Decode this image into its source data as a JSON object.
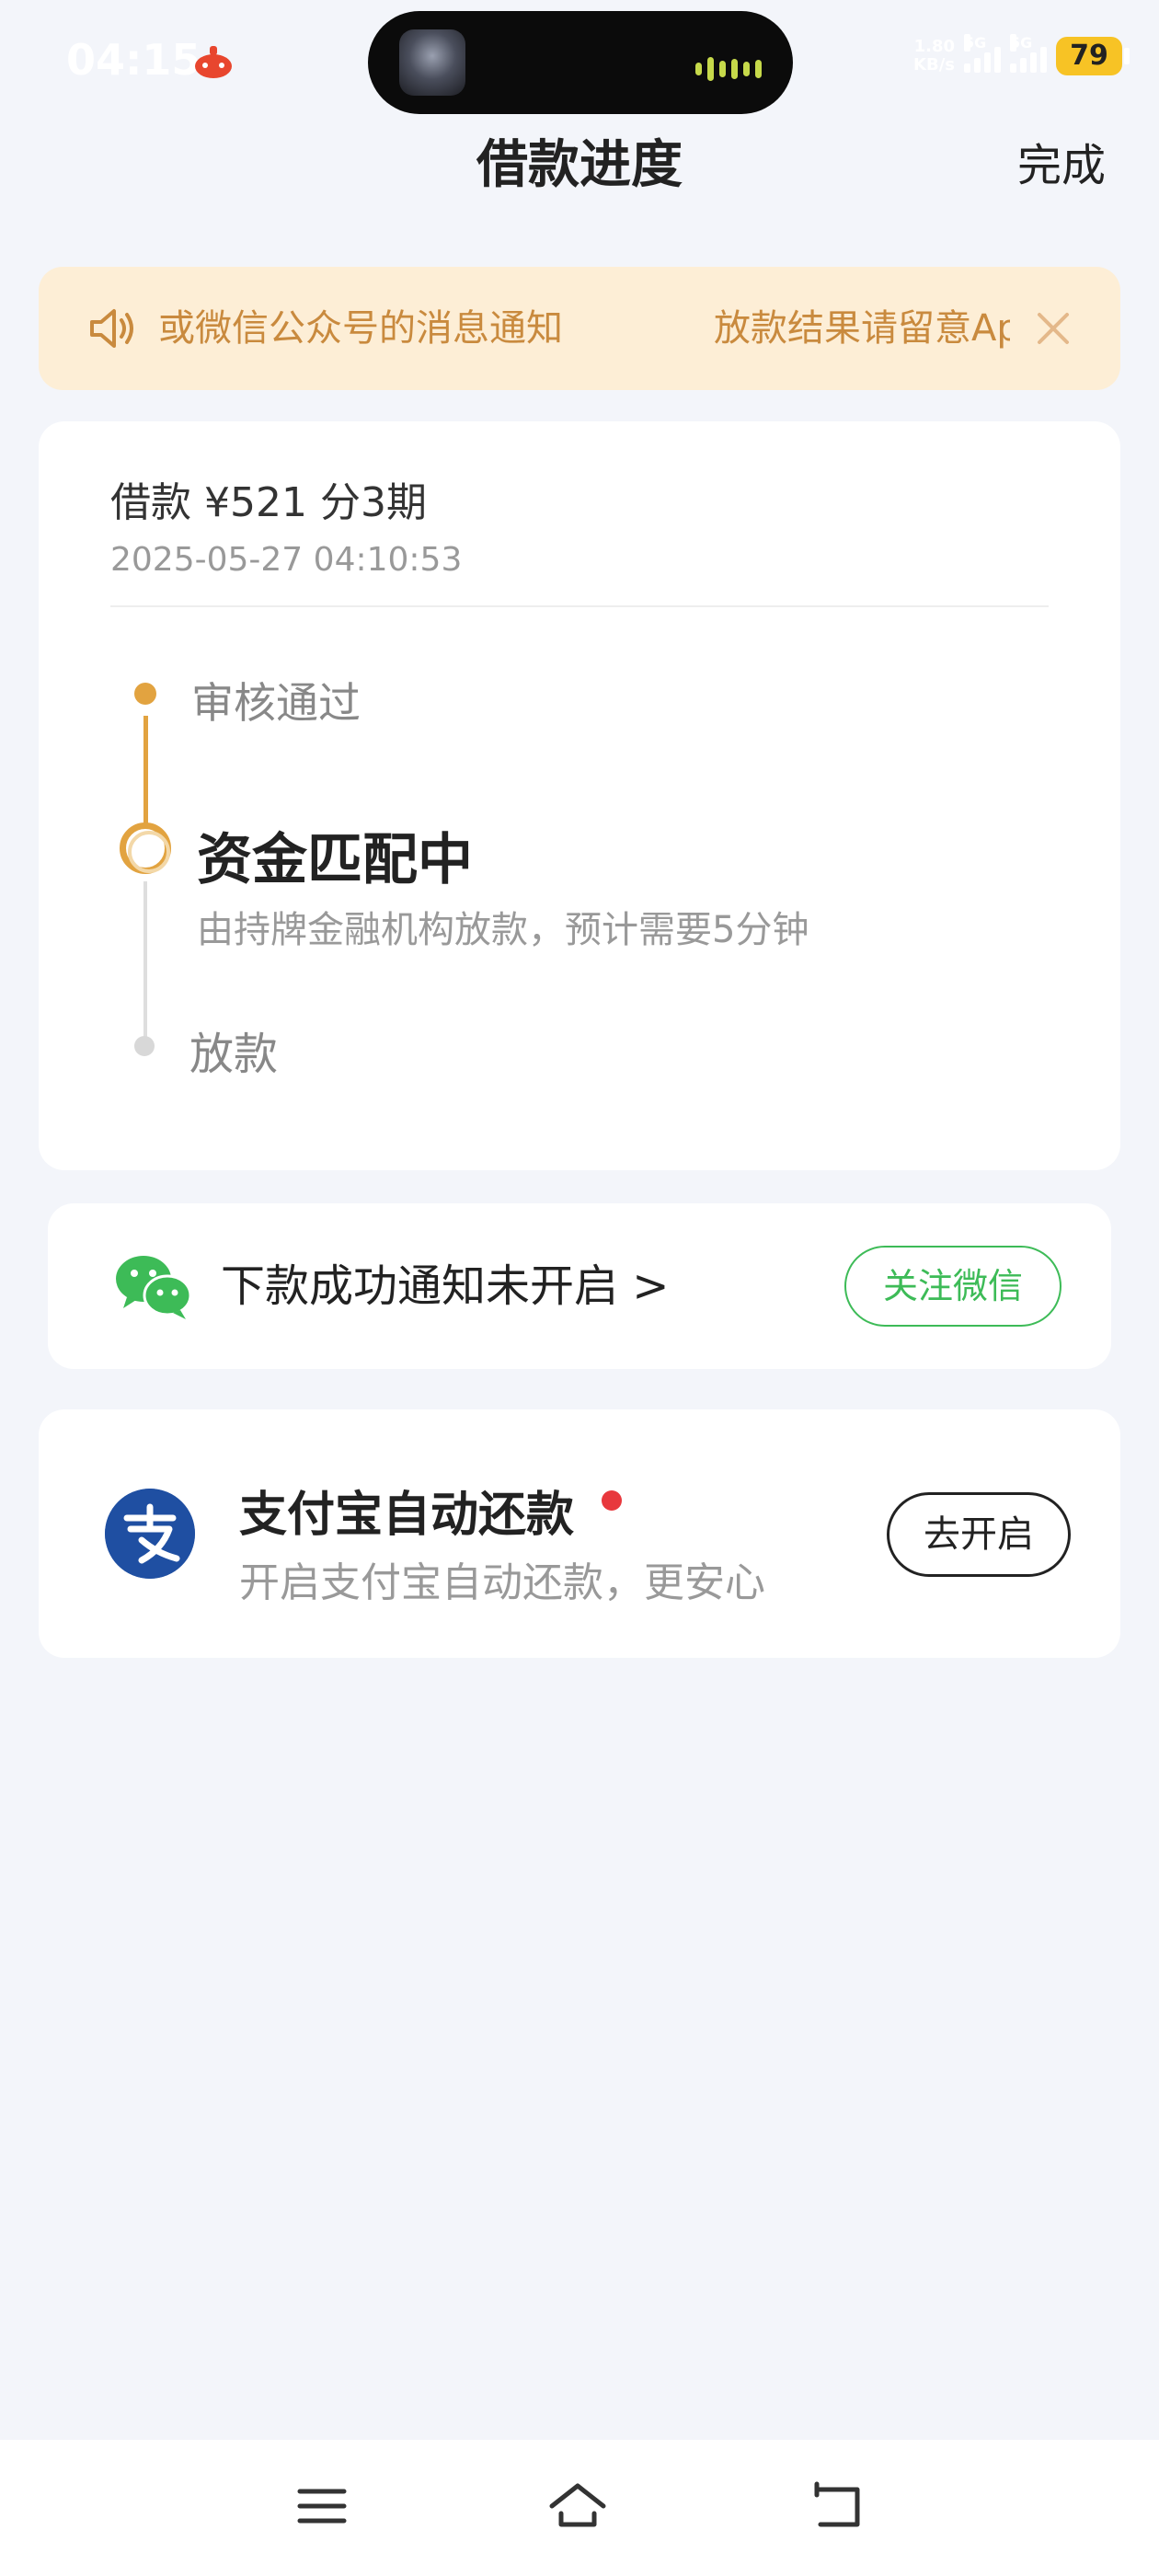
{
  "status_bar": {
    "time": "04:15",
    "net_speed_value": "1.80",
    "net_speed_unit": "KB/s",
    "signal_1_label": "5G",
    "signal_2_label": "5G",
    "battery": "79"
  },
  "header": {
    "title": "借款进度",
    "done_label": "完成"
  },
  "notice": {
    "text_part_a": "或微信公众号的消息通知",
    "text_part_b": "放款结果请留意App",
    "color": "#c98a3e"
  },
  "loan": {
    "summary": "借款 ¥521   分3期",
    "datetime": "2025-05-27 04:10:53"
  },
  "timeline": {
    "steps": [
      {
        "label": "审核通过",
        "state": "done"
      },
      {
        "label": "资金匹配中",
        "state": "current",
        "description": "由持牌金融机构放款，预计需要5分钟"
      },
      {
        "label": "放款",
        "state": "pending"
      }
    ],
    "active_color": "#e2a340"
  },
  "wechat": {
    "text": "下款成功通知未开启 >",
    "button_label": "关注微信",
    "icon": "wechat-icon",
    "color": "#3dbb57"
  },
  "alipay": {
    "title": "支付宝自动还款",
    "description": "开启支付宝自动还款，更安心",
    "button_label": "去开启",
    "icon": "alipay-icon",
    "color": "#1f4fa2"
  },
  "nav": {
    "icons": [
      "menu-icon",
      "home-icon",
      "back-icon"
    ]
  }
}
